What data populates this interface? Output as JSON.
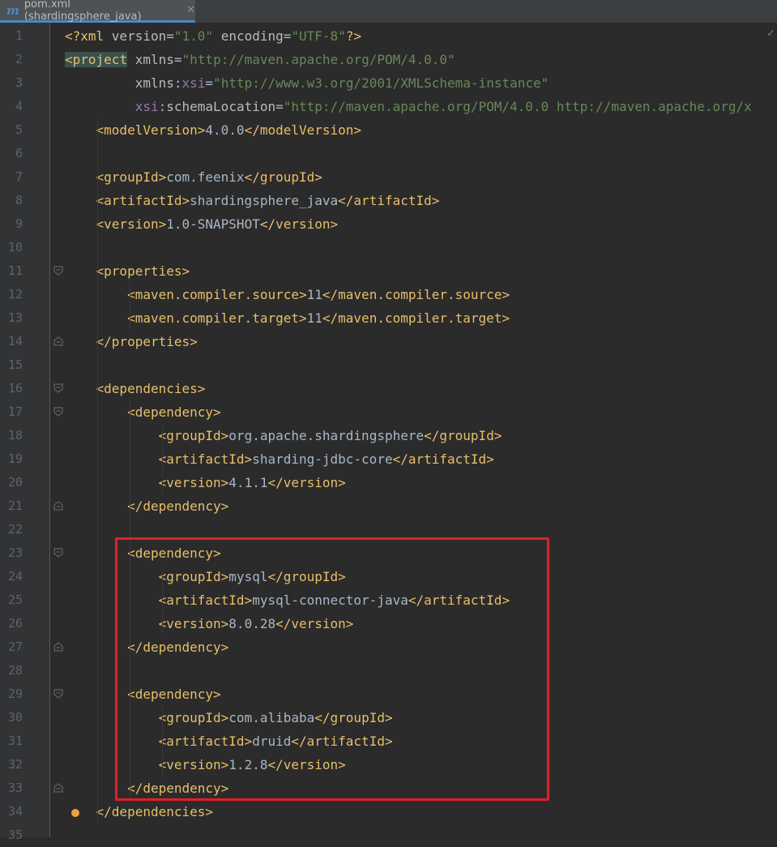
{
  "tab": {
    "icon": "maven-icon",
    "icon_glyph": "m",
    "title": "pom.xml (shardingsphere_java)",
    "close": "✕"
  },
  "lines": [
    {
      "n": "1",
      "tokens": [
        [
          "tag",
          "<?"
        ],
        [
          "tag",
          "xml "
        ],
        [
          "attr",
          "version"
        ],
        [
          "txt",
          "="
        ],
        [
          "val",
          "\"1.0\""
        ],
        [
          "txt",
          " "
        ],
        [
          "attr",
          "encoding"
        ],
        [
          "txt",
          "="
        ],
        [
          "val",
          "\"UTF-8\""
        ],
        [
          "tag",
          "?>"
        ]
      ]
    },
    {
      "n": "2",
      "tokens": [
        [
          "tag",
          "<"
        ],
        [
          "tag",
          "project"
        ],
        [
          "txt",
          " "
        ],
        [
          "attr",
          "xmlns"
        ],
        [
          "txt",
          "="
        ],
        [
          "val",
          "\"http://maven.apache.org/POM/4.0.0\""
        ]
      ]
    },
    {
      "n": "3",
      "tokens": [
        [
          "txt",
          "         "
        ],
        [
          "attr",
          "xmlns"
        ],
        [
          "txt",
          ":"
        ],
        [
          "ns",
          "xsi"
        ],
        [
          "txt",
          "="
        ],
        [
          "val",
          "\"http://www.w3.org/2001/XMLSchema-instance\""
        ]
      ]
    },
    {
      "n": "4",
      "tokens": [
        [
          "txt",
          "         "
        ],
        [
          "ns",
          "xsi"
        ],
        [
          "txt",
          ":"
        ],
        [
          "attr",
          "schemaLocation"
        ],
        [
          "txt",
          "="
        ],
        [
          "val",
          "\"http://maven.apache.org/POM/4.0.0 http://maven.apache.org/x"
        ]
      ]
    },
    {
      "n": "5",
      "tokens": [
        [
          "txt",
          "    "
        ],
        [
          "tag",
          "<modelVersion>"
        ],
        [
          "txt",
          "4.0.0"
        ],
        [
          "tag",
          "</modelVersion>"
        ]
      ]
    },
    {
      "n": "6",
      "tokens": []
    },
    {
      "n": "7",
      "tokens": [
        [
          "txt",
          "    "
        ],
        [
          "tag",
          "<groupId>"
        ],
        [
          "txt",
          "com.feenix"
        ],
        [
          "tag",
          "</groupId>"
        ]
      ]
    },
    {
      "n": "8",
      "tokens": [
        [
          "txt",
          "    "
        ],
        [
          "tag",
          "<artifactId>"
        ],
        [
          "txt",
          "shardingsphere_java"
        ],
        [
          "tag",
          "</artifactId>"
        ]
      ]
    },
    {
      "n": "9",
      "tokens": [
        [
          "txt",
          "    "
        ],
        [
          "tag",
          "<version>"
        ],
        [
          "txt",
          "1.0-SNAPSHOT"
        ],
        [
          "tag",
          "</version>"
        ]
      ]
    },
    {
      "n": "10",
      "tokens": []
    },
    {
      "n": "11",
      "tokens": [
        [
          "txt",
          "    "
        ],
        [
          "tag",
          "<properties>"
        ]
      ]
    },
    {
      "n": "12",
      "tokens": [
        [
          "txt",
          "        "
        ],
        [
          "tag",
          "<maven.compiler.source>"
        ],
        [
          "txt",
          "11"
        ],
        [
          "tag",
          "</maven.compiler.source>"
        ]
      ]
    },
    {
      "n": "13",
      "tokens": [
        [
          "txt",
          "        "
        ],
        [
          "tag",
          "<maven.compiler.target>"
        ],
        [
          "txt",
          "11"
        ],
        [
          "tag",
          "</maven.compiler.target>"
        ]
      ]
    },
    {
      "n": "14",
      "tokens": [
        [
          "txt",
          "    "
        ],
        [
          "tag",
          "</properties>"
        ]
      ]
    },
    {
      "n": "15",
      "tokens": []
    },
    {
      "n": "16",
      "tokens": [
        [
          "txt",
          "    "
        ],
        [
          "tag",
          "<dependencies>"
        ]
      ]
    },
    {
      "n": "17",
      "tokens": [
        [
          "txt",
          "        "
        ],
        [
          "tag",
          "<dependency>"
        ]
      ]
    },
    {
      "n": "18",
      "tokens": [
        [
          "txt",
          "            "
        ],
        [
          "tag",
          "<groupId>"
        ],
        [
          "txt",
          "org.apache.shardingsphere"
        ],
        [
          "tag",
          "</groupId>"
        ]
      ]
    },
    {
      "n": "19",
      "tokens": [
        [
          "txt",
          "            "
        ],
        [
          "tag",
          "<artifactId>"
        ],
        [
          "txt",
          "sharding-jdbc-core"
        ],
        [
          "tag",
          "</artifactId>"
        ]
      ]
    },
    {
      "n": "20",
      "tokens": [
        [
          "txt",
          "            "
        ],
        [
          "tag",
          "<version>"
        ],
        [
          "txt",
          "4.1.1"
        ],
        [
          "tag",
          "</version>"
        ]
      ]
    },
    {
      "n": "21",
      "tokens": [
        [
          "txt",
          "        "
        ],
        [
          "tag",
          "</dependency>"
        ]
      ]
    },
    {
      "n": "22",
      "tokens": []
    },
    {
      "n": "23",
      "tokens": [
        [
          "txt",
          "        "
        ],
        [
          "tag",
          "<dependency>"
        ]
      ]
    },
    {
      "n": "24",
      "tokens": [
        [
          "txt",
          "            "
        ],
        [
          "tag",
          "<groupId>"
        ],
        [
          "txt",
          "mysql"
        ],
        [
          "tag",
          "</groupId>"
        ]
      ]
    },
    {
      "n": "25",
      "tokens": [
        [
          "txt",
          "            "
        ],
        [
          "tag",
          "<artifactId>"
        ],
        [
          "txt",
          "mysql-connector-java"
        ],
        [
          "tag",
          "</artifactId>"
        ]
      ]
    },
    {
      "n": "26",
      "tokens": [
        [
          "txt",
          "            "
        ],
        [
          "tag",
          "<version>"
        ],
        [
          "txt",
          "8.0.28"
        ],
        [
          "tag",
          "</version>"
        ]
      ]
    },
    {
      "n": "27",
      "tokens": [
        [
          "txt",
          "        "
        ],
        [
          "tag",
          "</dependency>"
        ]
      ]
    },
    {
      "n": "28",
      "tokens": []
    },
    {
      "n": "29",
      "tokens": [
        [
          "txt",
          "        "
        ],
        [
          "tag",
          "<dependency>"
        ]
      ]
    },
    {
      "n": "30",
      "tokens": [
        [
          "txt",
          "            "
        ],
        [
          "tag",
          "<groupId>"
        ],
        [
          "txt",
          "com.alibaba"
        ],
        [
          "tag",
          "</groupId>"
        ]
      ]
    },
    {
      "n": "31",
      "tokens": [
        [
          "txt",
          "            "
        ],
        [
          "tag",
          "<artifactId>"
        ],
        [
          "txt",
          "druid"
        ],
        [
          "tag",
          "</artifactId>"
        ]
      ]
    },
    {
      "n": "32",
      "tokens": [
        [
          "txt",
          "            "
        ],
        [
          "tag",
          "<version>"
        ],
        [
          "txt",
          "1.2.8"
        ],
        [
          "tag",
          "</version>"
        ]
      ]
    },
    {
      "n": "33",
      "tokens": [
        [
          "txt",
          "        "
        ],
        [
          "tag",
          "</dependency>"
        ]
      ]
    },
    {
      "n": "34",
      "tokens": [
        [
          "txt",
          "    "
        ],
        [
          "tag",
          "</dependencies>"
        ]
      ]
    },
    {
      "n": "35",
      "tokens": []
    }
  ],
  "colors": {
    "background": "#2b2b2b",
    "tag": "#e8bf6a",
    "attribute": "#bababa",
    "namespace": "#9876aa",
    "string": "#6a8759",
    "text": "#a9b7c6",
    "highlight_box": "#e0202a"
  },
  "status": {
    "check_icon": "✓",
    "bulb_icon": "bulb-icon"
  }
}
